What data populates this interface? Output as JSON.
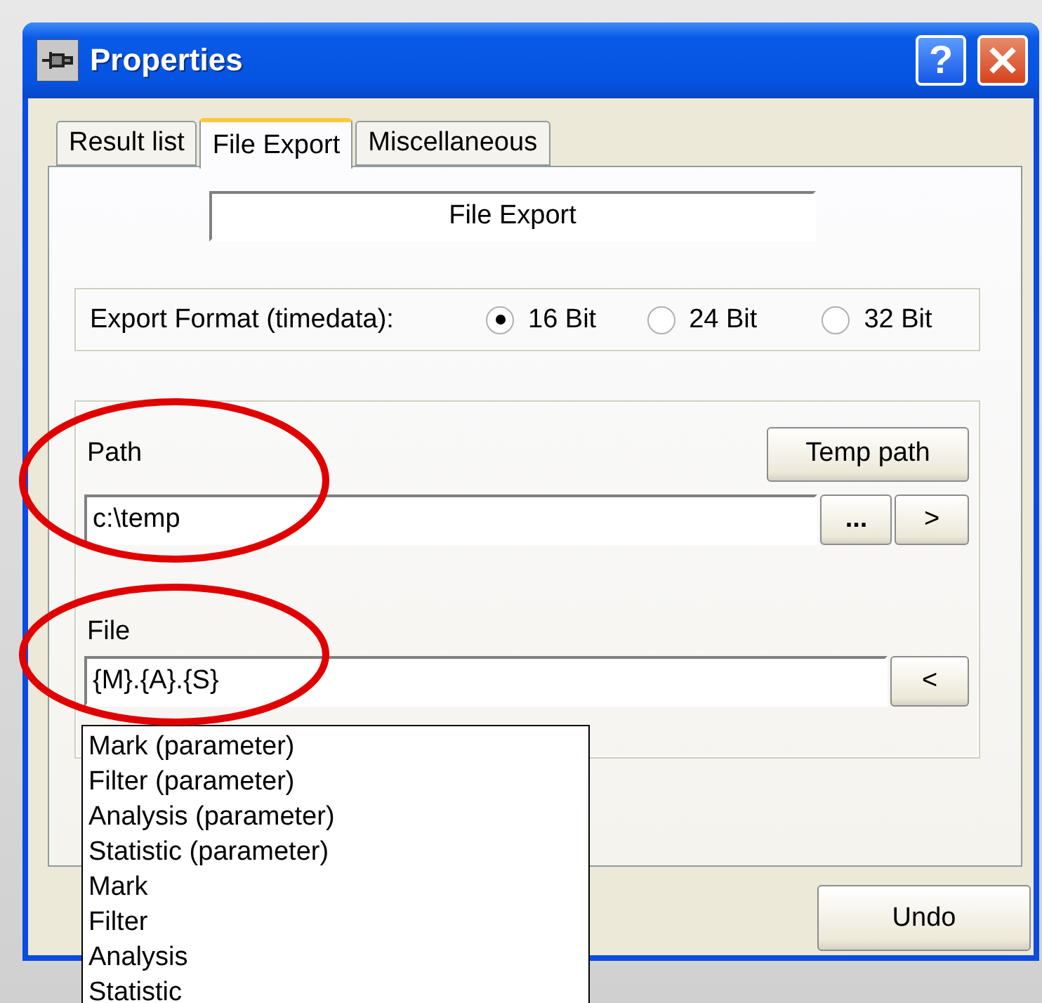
{
  "window": {
    "title": "Properties",
    "help_button": "?"
  },
  "tabs": [
    {
      "label": "Result list",
      "selected": false
    },
    {
      "label": "File Export",
      "selected": true
    },
    {
      "label": "Miscellaneous",
      "selected": false
    }
  ],
  "panel_title": "File Export",
  "export_format": {
    "label": "Export Format (timedata):",
    "options": [
      {
        "label": "16 Bit",
        "selected": true
      },
      {
        "label": "24 Bit",
        "selected": false
      },
      {
        "label": "32 Bit",
        "selected": false
      }
    ]
  },
  "path": {
    "label": "Path",
    "value": "c:\\temp",
    "temp_button": "Temp path",
    "browse_button": "...",
    "apply_button": ">"
  },
  "file": {
    "label": "File",
    "value": "{M}.{A}.{S}",
    "insert_button": "<"
  },
  "dropdown": {
    "items": [
      "Mark (parameter)",
      "Filter (parameter)",
      "Analysis (parameter)",
      "Statistic (parameter)",
      "Mark",
      "Filter",
      "Analysis",
      "Statistic"
    ]
  },
  "undo_button": "Undo"
}
